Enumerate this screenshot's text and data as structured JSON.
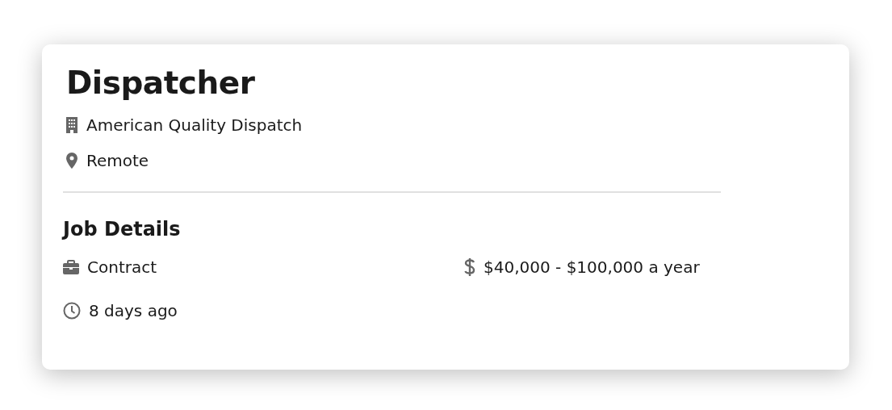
{
  "job": {
    "title": "Dispatcher",
    "company": "American Quality Dispatch",
    "location": "Remote"
  },
  "details": {
    "heading": "Job Details",
    "items": [
      {
        "kind": "type",
        "text": "Contract"
      },
      {
        "kind": "salary",
        "text": "$40,000 - $100,000 a year"
      },
      {
        "kind": "posted",
        "text": "8 days ago"
      }
    ]
  }
}
